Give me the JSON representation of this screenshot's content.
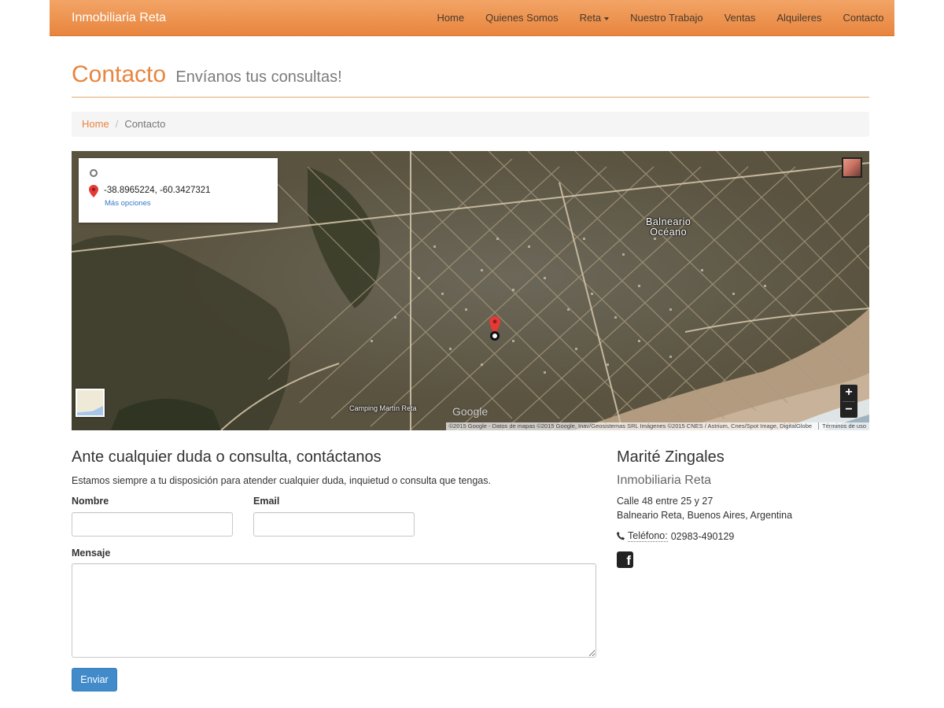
{
  "navbar": {
    "brand": "Inmobiliaria Reta",
    "items": [
      {
        "label": "Home"
      },
      {
        "label": "Quienes Somos"
      },
      {
        "label": "Reta"
      },
      {
        "label": "Nuestro Trabajo"
      },
      {
        "label": "Ventas"
      },
      {
        "label": "Alquileres"
      },
      {
        "label": "Contacto"
      }
    ],
    "colors": {
      "gradient_top": "#f2a466",
      "gradient_bottom": "#e8853e"
    }
  },
  "header": {
    "title": "Contacto",
    "subtitle": "Envíanos tus consultas!"
  },
  "breadcrumb": {
    "home": "Home",
    "separator": "/",
    "current": "Contacto"
  },
  "map": {
    "coordinates": "-38.8965224, -60.3427321",
    "more_options": "Más opciones",
    "town_label_line1": "Balneario",
    "town_label_line2": "Océano",
    "camping_label": "Camping Martín Reta",
    "logo": "Google",
    "attribution": "©2015 Google - Datos de mapas ©2015 Google, Inav/Geosistemas SRL Imágenes ©2015 CNES / Astrium, Cnes/Spot Image, DigitalGlobe",
    "terms": "Términos de uso",
    "zoom_in": "+",
    "zoom_out": "−"
  },
  "form": {
    "title": "Ante cualquier duda o consulta, contáctanos",
    "description": "Estamos siempre a tu disposición para atender cualquier duda, inquietud o consulta que tengas.",
    "name_label": "Nombre",
    "name_value": "",
    "email_label": "Email",
    "email_value": "",
    "message_label": "Mensaje",
    "message_value": "",
    "submit_label": "Enviar",
    "submit_color": "#428bca"
  },
  "contact_info": {
    "name": "Marité Zingales",
    "company": "Inmobiliaria Reta",
    "address_line1": "Calle 48 entre 25 y 27",
    "address_line2": "Balneario Reta, Buenos Aires, Argentina",
    "phone_label": "Teléfono:",
    "phone": "02983-490129",
    "social_icon": "facebook-icon"
  }
}
